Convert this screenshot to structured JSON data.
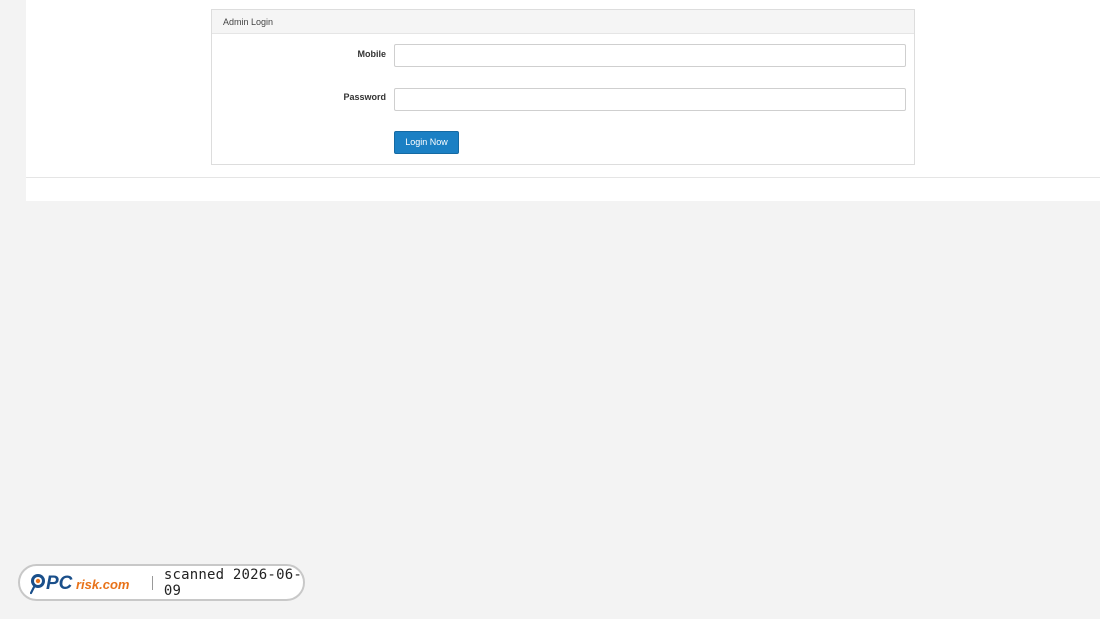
{
  "panel": {
    "title": "Admin Login"
  },
  "form": {
    "mobile_label": "Mobile",
    "mobile_value": "",
    "password_label": "Password",
    "password_value": "",
    "submit_label": "Login Now"
  },
  "watermark": {
    "brand": "PCrisk.com",
    "text": "scanned 2026-06-09"
  },
  "colors": {
    "accent": "#1b80c4",
    "page_background": "#f3f3f3",
    "panel_heading_background": "#f5f5f5"
  }
}
